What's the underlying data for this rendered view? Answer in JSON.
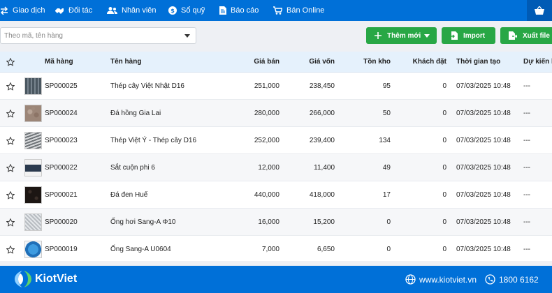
{
  "nav": {
    "items": [
      {
        "label": "Giao dịch",
        "icon": "transfer-arrows-icon"
      },
      {
        "label": "Đối tác",
        "icon": "handshake-icon"
      },
      {
        "label": "Nhân viên",
        "icon": "users-icon"
      },
      {
        "label": "Sổ quỹ",
        "icon": "dollar-circle-icon"
      },
      {
        "label": "Báo cáo",
        "icon": "report-document-icon"
      },
      {
        "label": "Bán Online",
        "icon": "cart-icon"
      }
    ],
    "cart_icon": "shopping-basket-icon"
  },
  "toolbar": {
    "search_placeholder": "Theo mã, tên hàng",
    "add_label": "Thêm mới",
    "import_label": "Import",
    "export_label": "Xuất file"
  },
  "table": {
    "headers": {
      "code": "Mã hàng",
      "name": "Tên hàng",
      "price": "Giá bán",
      "cost": "Giá vốn",
      "stock": "Tồn kho",
      "ordered": "Khách đặt",
      "created": "Thời gian tạo",
      "expected": "Dự kiến hết hàng"
    },
    "rows": [
      {
        "code": "SP000025",
        "name": "Thép cây Việt Nhật D16",
        "price": "251,000",
        "cost": "238,450",
        "stock": "95",
        "ordered": "0",
        "created": "07/03/2025 10:48",
        "expected": "---"
      },
      {
        "code": "SP000024",
        "name": "Đá hồng Gia Lai",
        "price": "280,000",
        "cost": "266,000",
        "stock": "50",
        "ordered": "0",
        "created": "07/03/2025 10:48",
        "expected": "---"
      },
      {
        "code": "SP000023",
        "name": "Thép Việt Ý - Thép cây D16",
        "price": "252,000",
        "cost": "239,400",
        "stock": "134",
        "ordered": "0",
        "created": "07/03/2025 10:48",
        "expected": "---"
      },
      {
        "code": "SP000022",
        "name": "Sắt cuộn phi 6",
        "price": "12,000",
        "cost": "11,400",
        "stock": "49",
        "ordered": "0",
        "created": "07/03/2025 10:48",
        "expected": "---"
      },
      {
        "code": "SP000021",
        "name": "Đá đen Huế",
        "price": "440,000",
        "cost": "418,000",
        "stock": "17",
        "ordered": "0",
        "created": "07/03/2025 10:48",
        "expected": "---"
      },
      {
        "code": "SP000020",
        "name": "Ống hơi Sang-A Φ10",
        "price": "16,000",
        "cost": "15,200",
        "stock": "0",
        "ordered": "0",
        "created": "07/03/2025 10:48",
        "expected": "---"
      },
      {
        "code": "SP000019",
        "name": "Ống Sang-A U0604",
        "price": "7,000",
        "cost": "6,650",
        "stock": "0",
        "ordered": "0",
        "created": "07/03/2025 10:48",
        "expected": "---"
      }
    ]
  },
  "footer": {
    "brand": "KiotViet",
    "website": "www.kiotviet.vn",
    "phone": "1800 6162"
  },
  "colors": {
    "primary": "#0070d8",
    "success": "#28a745",
    "header_bg": "#e5f1fc"
  }
}
